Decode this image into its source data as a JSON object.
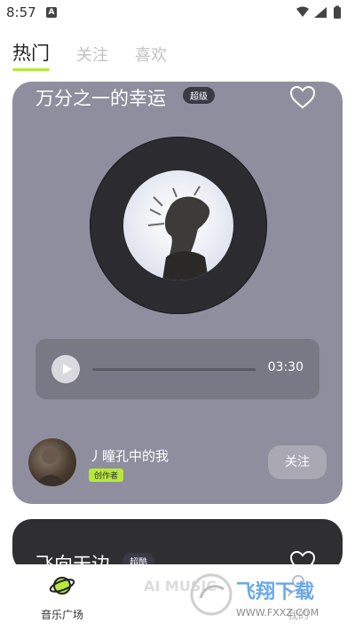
{
  "status_bar": {
    "time": "8:57",
    "notification_letter": "A"
  },
  "tabs": [
    {
      "label": "热门",
      "active": true
    },
    {
      "label": "关注",
      "active": false
    },
    {
      "label": "喜欢",
      "active": false
    }
  ],
  "cards": [
    {
      "title": "万分之一的幸运",
      "tag": "超级",
      "icon": "heart-outline-icon",
      "duration": "03:30",
      "user": {
        "name": "丿瞳孔中的我",
        "badge": "创作者"
      },
      "follow_label": "关注",
      "background": "#8f8e9e"
    },
    {
      "title": "飞向天边",
      "tag": "超酷",
      "icon": "heart-outline-icon",
      "background": "#2f2f31"
    }
  ],
  "bottom_nav": [
    {
      "label": "音乐广场",
      "icon": "planet-icon",
      "active": true
    },
    {
      "label": "我的",
      "icon": "profile-icon",
      "active": false
    }
  ],
  "watermark": {
    "left_text": "AI MUSIC",
    "brand": "飞翔下载",
    "url": "WWW.FXXZ.COM"
  },
  "colors": {
    "accent": "#b7e83b",
    "card_gray": "#8f8e9e",
    "player_bg": "#797985"
  }
}
